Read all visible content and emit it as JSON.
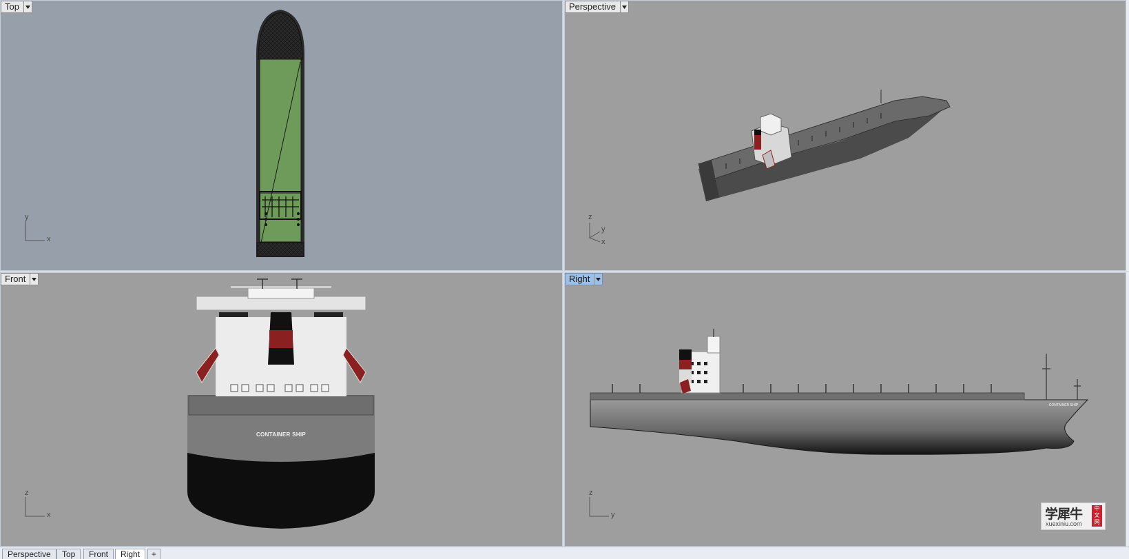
{
  "viewports": {
    "top": {
      "label": "Top",
      "axis_a": "y",
      "axis_b": "x"
    },
    "perspective": {
      "label": "Perspective",
      "axis_a": "z",
      "axis_b": "y",
      "axis_c": "x"
    },
    "front": {
      "label": "Front",
      "axis_a": "z",
      "axis_b": "x",
      "hull_text": "CONTAINER SHIP"
    },
    "right": {
      "label": "Right",
      "axis_a": "z",
      "axis_b": "y",
      "hull_text": "CONTAINER SHIP",
      "active": true
    }
  },
  "tabs": [
    "Perspective",
    "Top",
    "Front",
    "Right"
  ],
  "tab_add_icon": "plus-icon",
  "active_tab": "Right",
  "watermark": {
    "main": "学犀牛",
    "seal": "中文网",
    "site": "xuexiniu.com"
  },
  "colors": {
    "top_bg": "#97a0aa",
    "shaded_bg": "#9e9e9e",
    "active_label": "#9cc0e7",
    "deck_green": "#6e9a5a",
    "funnel_red": "#8b2020"
  }
}
